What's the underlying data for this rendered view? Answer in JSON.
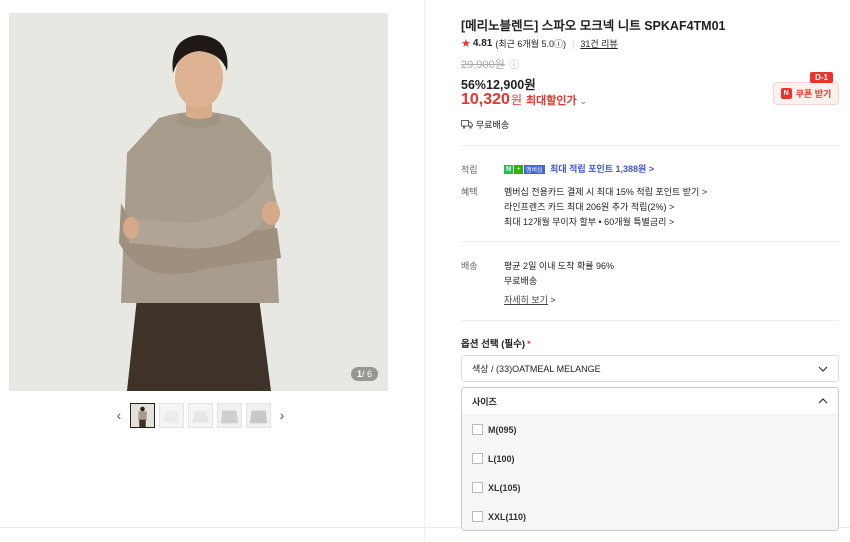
{
  "gallery": {
    "counter_current": "1",
    "counter_total": "/ 6",
    "prev_label": "‹",
    "next_label": "›"
  },
  "product": {
    "title": "[메리노블렌드] 스파오 모크넥 니트 SPKAF4TM01",
    "rating": "4.81",
    "rating_detail": "(최근 6개월 5.0ⓘ)",
    "review_count": "31건 리뷰",
    "original_price": "29,900원",
    "original_price_info": "ⓘ",
    "sale_price": "56%12,900원",
    "max_price": "10,320",
    "max_price_unit": "원",
    "max_price_label": "최대할인가",
    "shipping_short": "무료배송"
  },
  "coupon": {
    "badge": "D-1",
    "icon_letter": "N",
    "label": "쿠폰 받기"
  },
  "benefits": {
    "points_label": "적립",
    "points_badge_n": "N",
    "points_badge_plus": "+",
    "points_badge_mem": "멤버십",
    "points_text": "최대 적립 포인트 1,388원 >",
    "benefit_label": "혜택",
    "benefit_lines": [
      "멤버십 전용카드 결제 시 최대 15% 적립 포인트 받기 >",
      "라인프렌즈 카드 최대 206원 추가 적립(2%) >",
      "최대 12개월 무이자 할부 • 60개월 특별금리 >"
    ]
  },
  "delivery": {
    "label": "배송",
    "line1": "평균 2일 이내 도착 확률 96%",
    "line2": "무료배송",
    "detail_link": "자세히 보기",
    "detail_chev": ">"
  },
  "options": {
    "title": "옵션 선택 (필수)",
    "required_mark": "*",
    "color_value": "색상 / (33)OATMEAL MELANGE",
    "size_header": "사이즈",
    "sizes": [
      "M(095)",
      "L(100)",
      "XL(105)",
      "XXL(110)"
    ]
  },
  "colors": {
    "accent": "#e8352b",
    "points_blue": "#3e56d8",
    "naver_green": "#19c552"
  }
}
